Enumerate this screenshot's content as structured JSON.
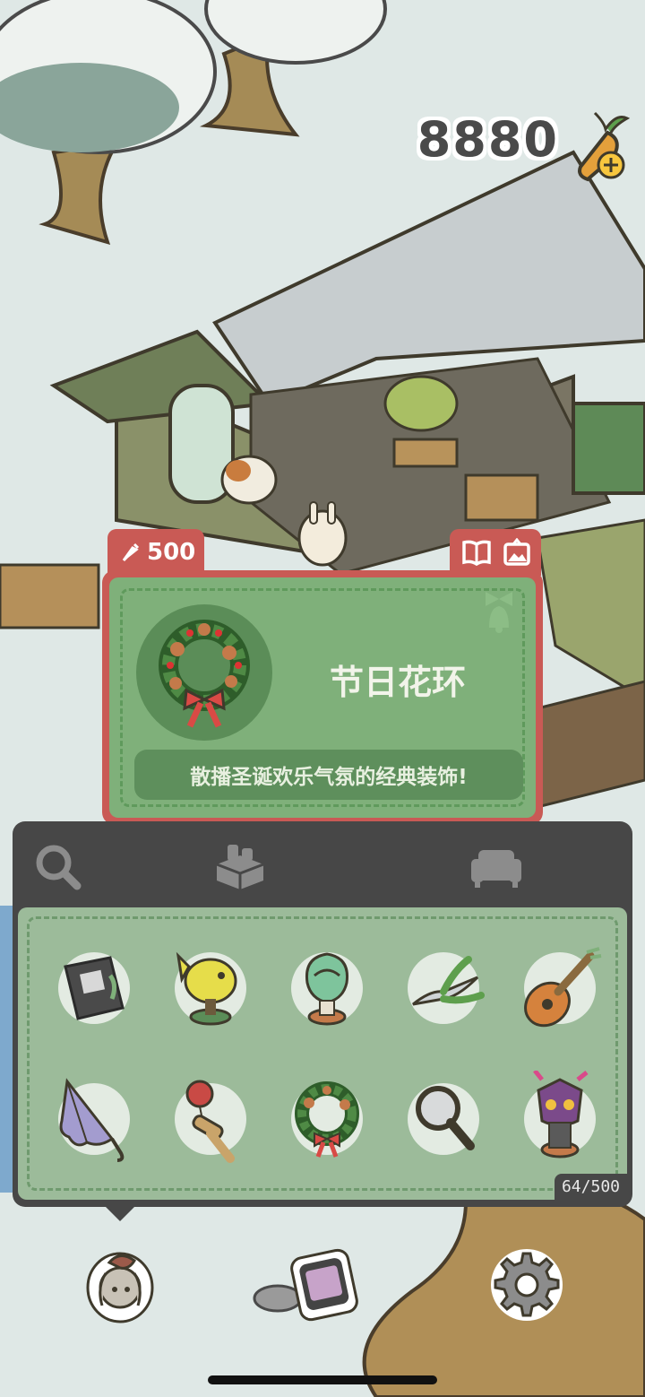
{
  "hud": {
    "carrot_count": "8880",
    "carrot_icon": "carrot-plus-icon"
  },
  "item_card": {
    "price": "500",
    "price_icon": "carrot-icon",
    "name": "节日花环",
    "description": "散播圣诞欢乐气氛的经典装饰!",
    "actions": [
      "book-icon",
      "photo-icon"
    ],
    "category_icon": "bell-bow-icon"
  },
  "inventory": {
    "tabs": [
      "search-icon",
      "crate-icon",
      "sofa-icon"
    ],
    "count": "64/500",
    "items": [
      {
        "name": "bonsai-book-icon"
      },
      {
        "name": "fish-trophy-icon"
      },
      {
        "name": "green-statue-icon"
      },
      {
        "name": "pruning-shears-icon"
      },
      {
        "name": "lute-icon"
      },
      {
        "name": "umbrella-icon"
      },
      {
        "name": "kendama-icon"
      },
      {
        "name": "wreath-icon"
      },
      {
        "name": "magnifier-icon"
      },
      {
        "name": "mask-statue-icon"
      }
    ]
  },
  "bottom_bar": [
    "rabbit-avatar-icon",
    "phone-icon",
    "settings-gear-icon"
  ],
  "colors": {
    "card_red": "#c95a55",
    "card_green": "#7fb07a",
    "panel_dark": "#474747",
    "grid_green": "#9cbb9a"
  }
}
